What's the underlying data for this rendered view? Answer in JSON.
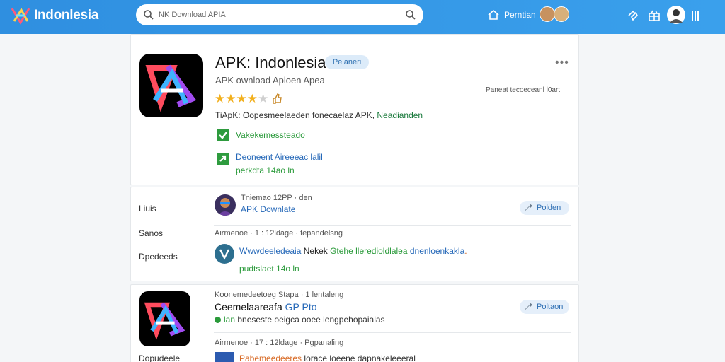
{
  "brand": {
    "name": "Indonlesia"
  },
  "search": {
    "placeholder": "NK Download APIA"
  },
  "topbar": {
    "home_label": "Perntian"
  },
  "app": {
    "title": "APK: Indonlesia",
    "badge": "Pelaneri",
    "subtitle": "APK ownload  Aploen  Apea",
    "rating": 4,
    "meta": "Paneat tecoeceanl    l0art",
    "desc_prefix": "TiApK: Oopesmeelaeden fonecaelaz APK,",
    "desc_highlight": "Neadianden",
    "check_label": "Vakekemessteado",
    "download_label": "Deoneent Aireeeac lalil",
    "download_size": "perkdta 14ao ln"
  },
  "sidebar": {
    "items": [
      {
        "label": "Liuis"
      },
      {
        "label": "Sanos"
      },
      {
        "label": "Dpedeeds"
      },
      {
        "label": "Dopudeele"
      }
    ]
  },
  "review": {
    "user_meta": "Tniemao 12PP · den",
    "title": "APK Downlate",
    "pill": "Polden",
    "meta2": "Airmenoe · 1 : 12ldage · tepandelsng",
    "comment_blue": "Wwwdeeledeaia",
    "comment_dark": "Nekek",
    "comment_green": "Gtehe lleredioldlalea",
    "comment_blue2": "dnenloenkakla",
    "comment_orange": ".",
    "comment_size": "pudtslaet 14o ln"
  },
  "second": {
    "meta": "Koonemedeetoeg Stapa · 1 lentaleng",
    "title": "Ceemelaareafa",
    "title_blue": "GP Pto",
    "pill": "Poltaon",
    "status_green": "lan",
    "status_text": "bneseste oeigca ooee lengpehopaialas",
    "meta2": "Airmenoe · 17 : 12ldage · Pgpanaling",
    "row_orange": "Pabemeedeeres",
    "row_text": "lorace loeene dapnakeleeeral"
  }
}
